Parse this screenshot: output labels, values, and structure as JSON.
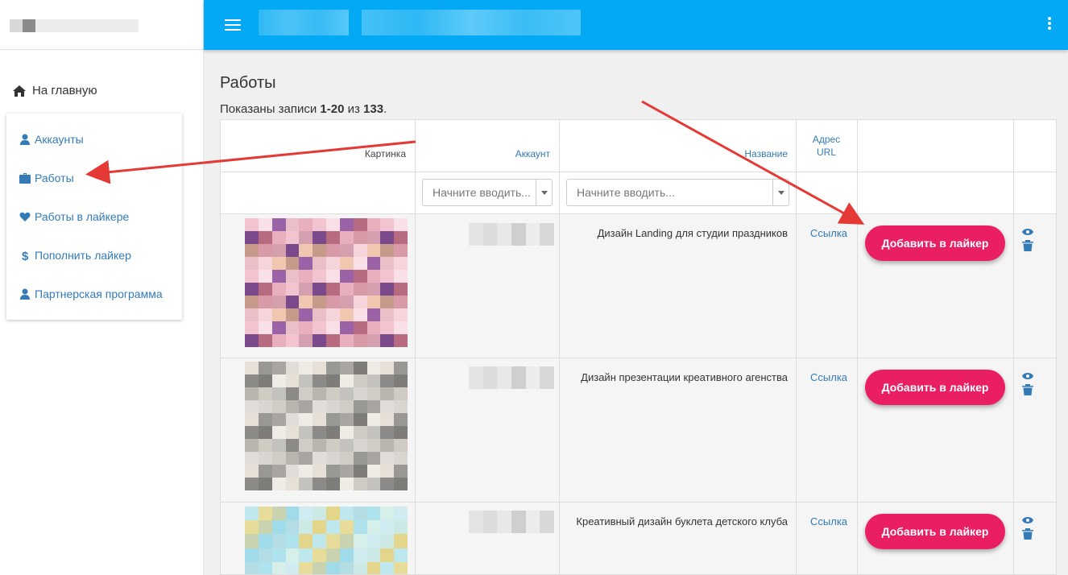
{
  "sidebar": {
    "home_label": "На главную",
    "items": [
      {
        "label": "Аккаунты",
        "icon": "user-icon"
      },
      {
        "label": "Работы",
        "icon": "briefcase-icon"
      },
      {
        "label": "Работы в лайкере",
        "icon": "heart-icon"
      },
      {
        "label": "Пополнить лайкер",
        "icon": "dollar-icon"
      },
      {
        "label": "Партнерская программа",
        "icon": "user-icon"
      }
    ]
  },
  "colors": {
    "topbar": "#03a9f4",
    "accent_button": "#e91e63",
    "link": "#337ab7",
    "annotation_arrow": "#e53935"
  },
  "page": {
    "title": "Работы",
    "summary_prefix": "Показаны записи ",
    "summary_range": "1-20",
    "summary_mid": " из ",
    "summary_total": "133",
    "summary_suffix": "."
  },
  "table": {
    "headers": {
      "image": "Картинка",
      "account": "Аккаунт",
      "name": "Название",
      "url_line1": "Адрес",
      "url_line2": "URL"
    },
    "filters": {
      "account_placeholder": "Начните вводить...",
      "name_placeholder": "Начните вводить..."
    },
    "rows": [
      {
        "name": "Дизайн Landing для студии праздников",
        "url_label": "Ссылка",
        "button_label": "Добавить в лайкер"
      },
      {
        "name": "Дизайн презентации креативного агенства",
        "url_label": "Ссылка",
        "button_label": "Добавить в лайкер"
      },
      {
        "name": "Креативный дизайн буклета детского клуба",
        "url_label": "Ссылка",
        "button_label": "Добавить в лайкер"
      }
    ]
  }
}
